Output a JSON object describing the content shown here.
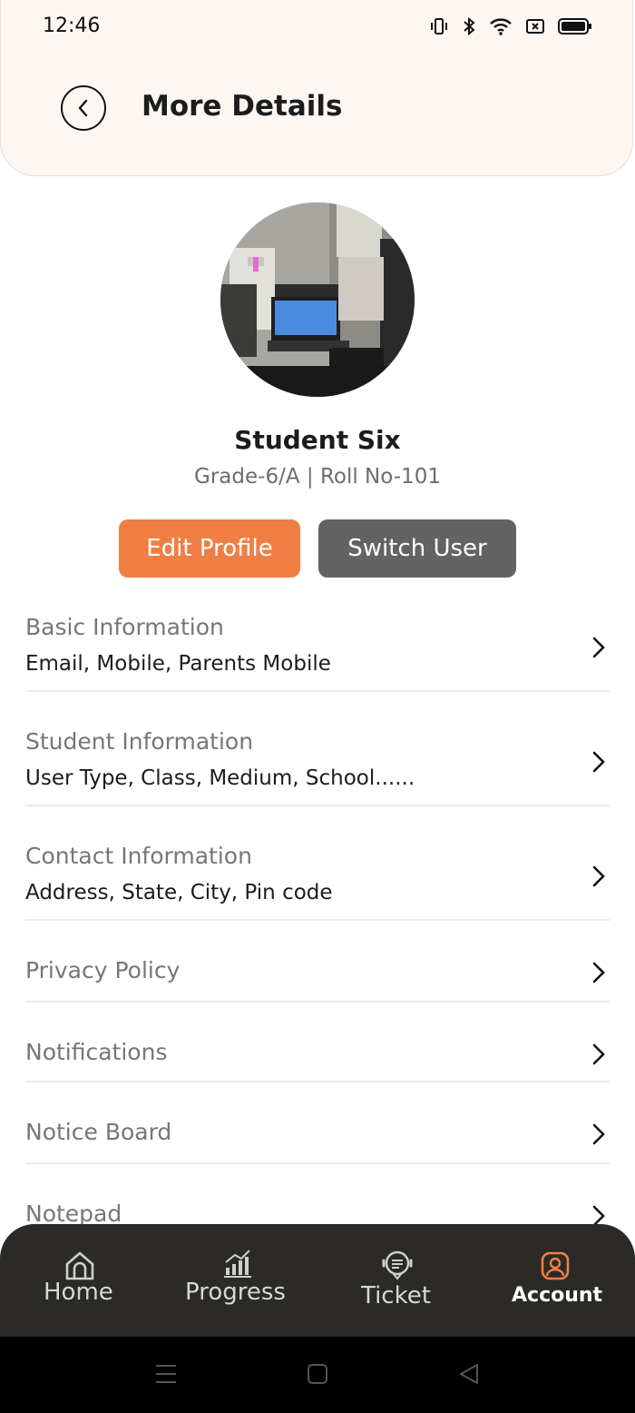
{
  "status": {
    "time": "12:46"
  },
  "header": {
    "title": "More Details"
  },
  "profile": {
    "name": "Student Six",
    "subtitle": "Grade-6/A | Roll No-101",
    "edit_label": "Edit Profile",
    "switch_label": "Switch User"
  },
  "menu": [
    {
      "title": "Basic Information",
      "subtitle": "Email, Mobile, Parents Mobile"
    },
    {
      "title": "Student Information",
      "subtitle": "User Type, Class, Medium, School......"
    },
    {
      "title": "Contact Information",
      "subtitle": "Address, State, City, Pin code"
    },
    {
      "title": "Privacy Policy"
    },
    {
      "title": "Notifications"
    },
    {
      "title": "Notice Board"
    },
    {
      "title": "Notepad"
    }
  ],
  "nav": [
    {
      "label": "Home",
      "icon": "home-icon"
    },
    {
      "label": "Progress",
      "icon": "progress-icon"
    },
    {
      "label": "Ticket",
      "icon": "ticket-icon"
    },
    {
      "label": "Account",
      "icon": "account-icon",
      "active": true
    }
  ],
  "colors": {
    "accent": "#ef7f45",
    "secondary_button": "#636363",
    "nav_bg": "#2b2a27",
    "header_bg": "#fdf7f3"
  }
}
